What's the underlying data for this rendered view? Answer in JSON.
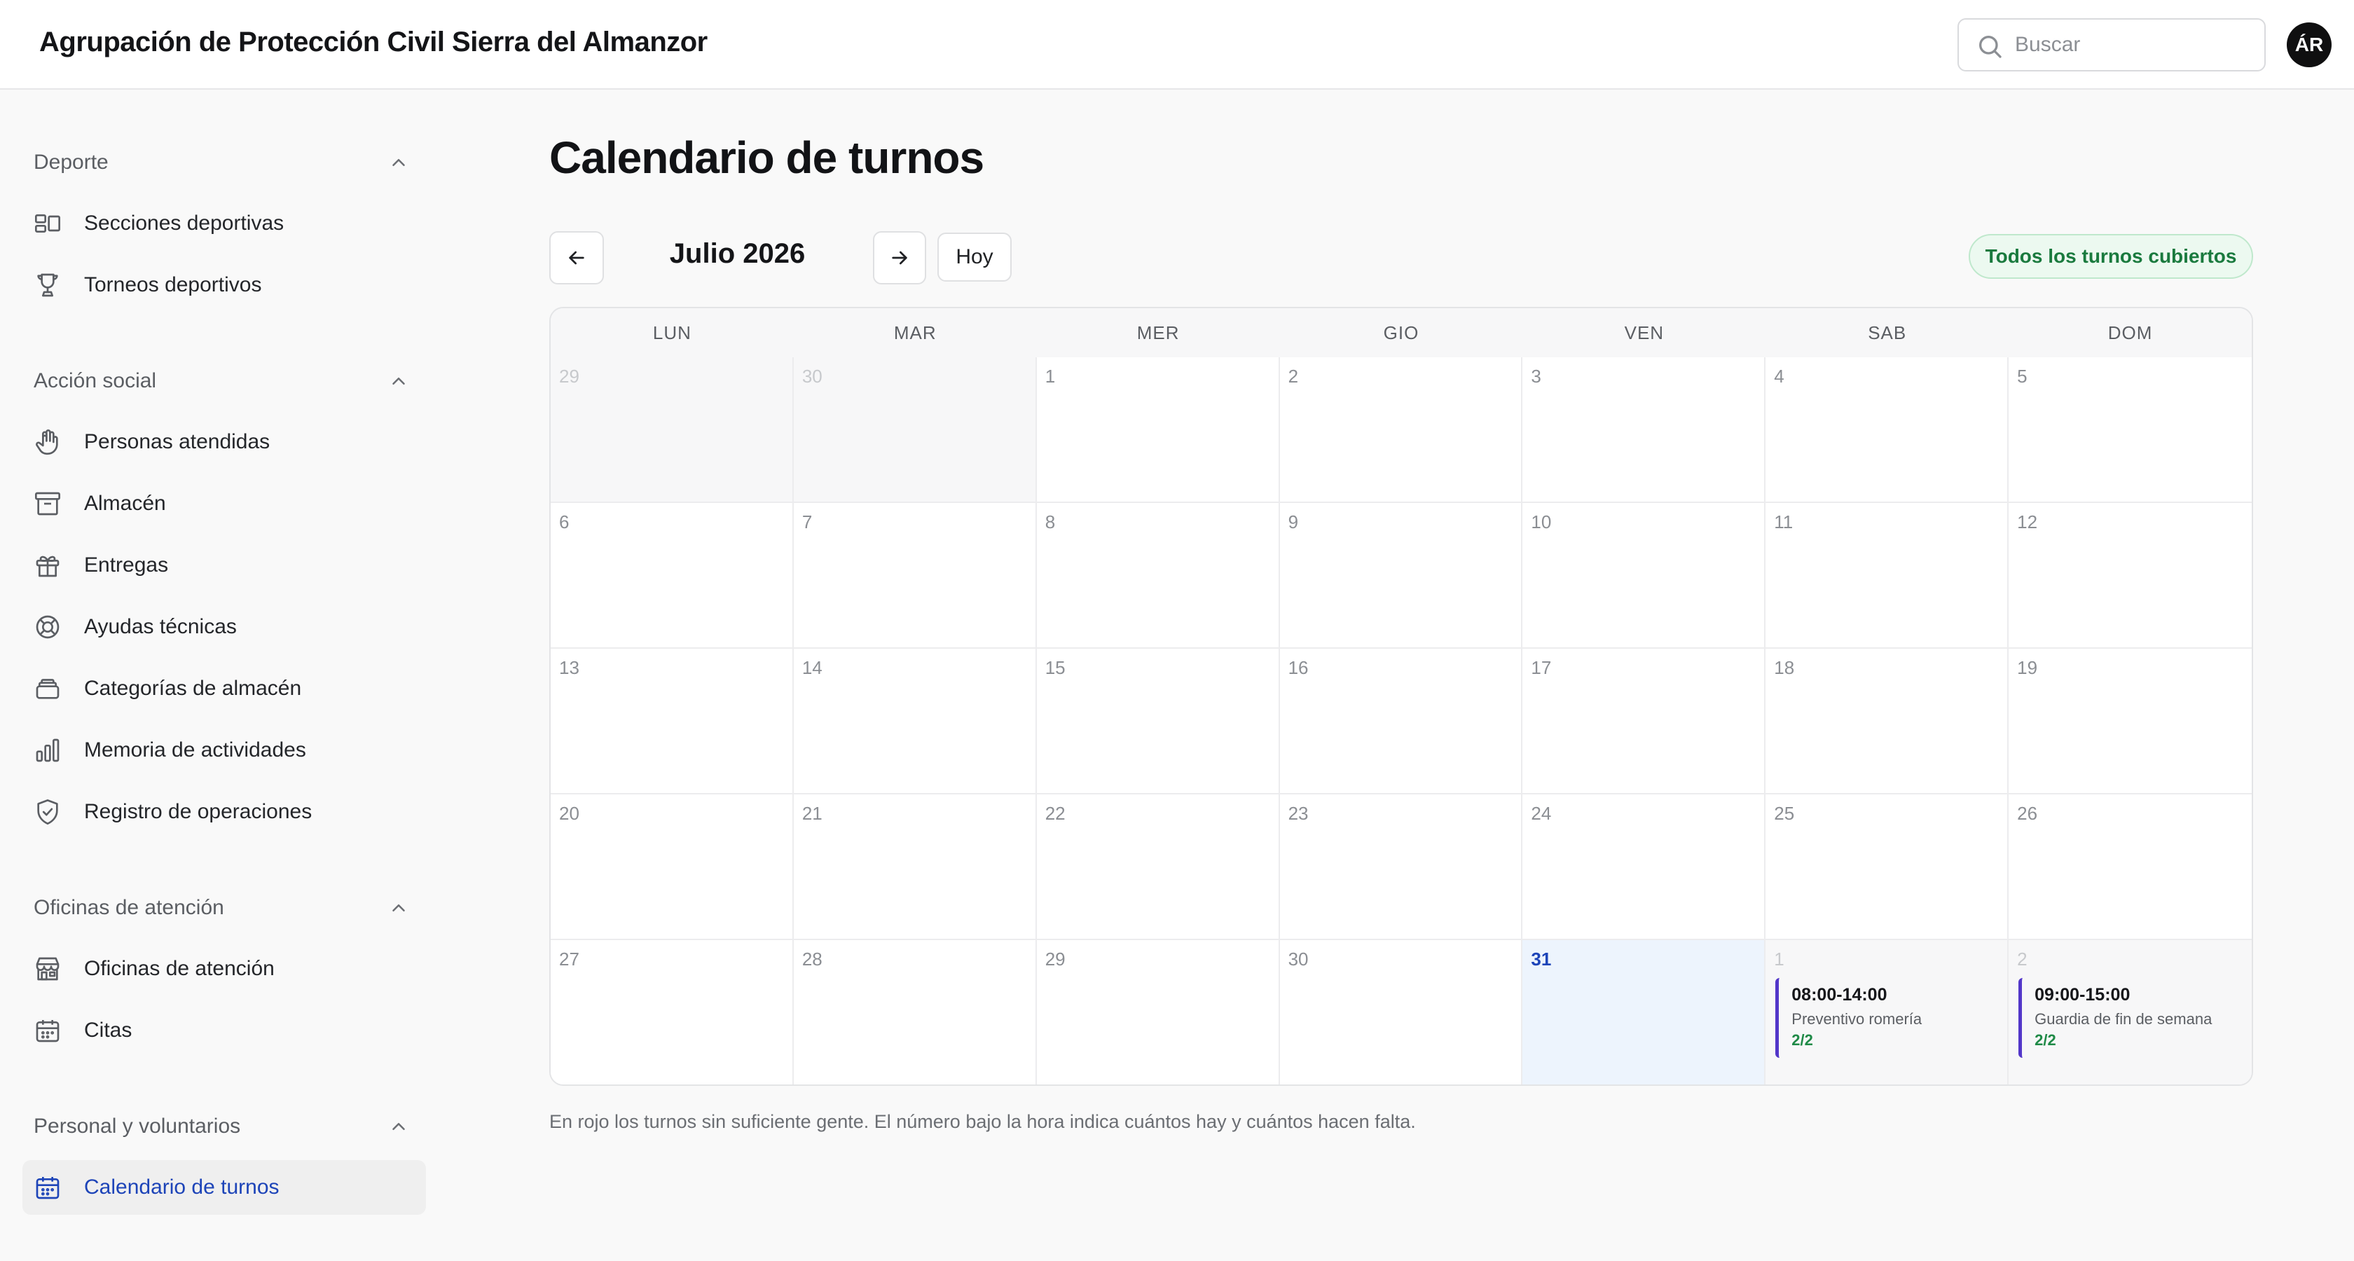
{
  "app": {
    "title": "Agrupación de Protección Civil Sierra del Almanzor"
  },
  "search": {
    "placeholder": "Buscar",
    "value": ""
  },
  "user": {
    "initials": "ÁR"
  },
  "sidebar": {
    "sections": [
      {
        "label": "Deporte",
        "items": [
          {
            "label": "Secciones deportivas",
            "icon": "sections-icon"
          },
          {
            "label": "Torneos deportivos",
            "icon": "trophy-icon"
          }
        ]
      },
      {
        "label": "Acción social",
        "items": [
          {
            "label": "Personas atendidas",
            "icon": "hand-icon"
          },
          {
            "label": "Almacén",
            "icon": "archive-box-icon"
          },
          {
            "label": "Entregas",
            "icon": "gift-icon"
          },
          {
            "label": "Ayudas técnicas",
            "icon": "lifebuoy-icon"
          },
          {
            "label": "Categorías de almacén",
            "icon": "stack-icon"
          },
          {
            "label": "Memoria de actividades",
            "icon": "bar-chart-icon"
          },
          {
            "label": "Registro de operaciones",
            "icon": "shield-check-icon"
          }
        ]
      },
      {
        "label": "Oficinas de atención",
        "items": [
          {
            "label": "Oficinas de atención",
            "icon": "building-icon"
          },
          {
            "label": "Citas",
            "icon": "calendar-icon"
          }
        ]
      },
      {
        "label": "Personal y voluntarios",
        "items": [
          {
            "label": "Calendario de turnos",
            "icon": "calendar-icon",
            "active": true
          }
        ]
      }
    ]
  },
  "main": {
    "title": "Calendario de turnos",
    "month_label": "Julio 2026",
    "today_label": "Hoy",
    "status": "Todos los turnos cubiertos",
    "weekdays": [
      "LUN",
      "MAR",
      "MER",
      "GIO",
      "VEN",
      "SAB",
      "DOM"
    ],
    "weeks": [
      [
        {
          "day": "29",
          "other": true
        },
        {
          "day": "30",
          "other": true
        },
        {
          "day": "1"
        },
        {
          "day": "2"
        },
        {
          "day": "3"
        },
        {
          "day": "4"
        },
        {
          "day": "5"
        }
      ],
      [
        {
          "day": "6"
        },
        {
          "day": "7"
        },
        {
          "day": "8"
        },
        {
          "day": "9"
        },
        {
          "day": "10"
        },
        {
          "day": "11"
        },
        {
          "day": "12"
        }
      ],
      [
        {
          "day": "13"
        },
        {
          "day": "14"
        },
        {
          "day": "15"
        },
        {
          "day": "16"
        },
        {
          "day": "17"
        },
        {
          "day": "18"
        },
        {
          "day": "19"
        }
      ],
      [
        {
          "day": "20"
        },
        {
          "day": "21"
        },
        {
          "day": "22"
        },
        {
          "day": "23"
        },
        {
          "day": "24"
        },
        {
          "day": "25"
        },
        {
          "day": "26"
        }
      ],
      [
        {
          "day": "27"
        },
        {
          "day": "28"
        },
        {
          "day": "29"
        },
        {
          "day": "30"
        },
        {
          "day": "31",
          "today": true
        },
        {
          "day": "1",
          "other": true,
          "event": {
            "time": "08:00-14:00",
            "name": "Preventivo romería",
            "count": "2/2"
          }
        },
        {
          "day": "2",
          "other": true,
          "event": {
            "time": "09:00-15:00",
            "name": "Guardia de fin de semana",
            "count": "2/2"
          }
        }
      ]
    ],
    "note": "En rojo los turnos sin suficiente gente. El número bajo la hora indica cuántos hay y cuántos hacen falta."
  },
  "colors": {
    "accent": "#1d44b8",
    "event_bar": "#5236c9",
    "covered_green": "#1a7a3e",
    "today_bg": "#edf4fd"
  }
}
